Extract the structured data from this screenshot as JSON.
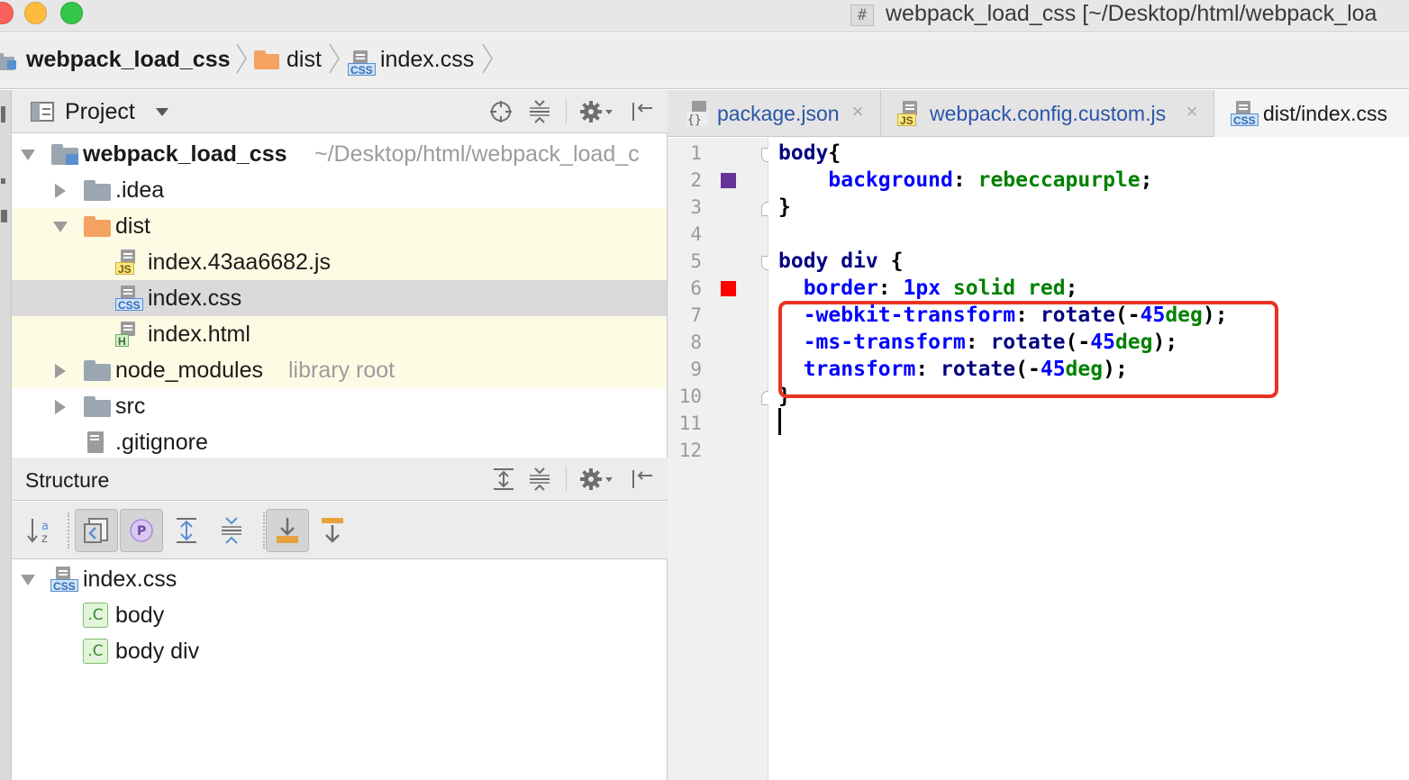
{
  "window": {
    "title": "webpack_load_css [~/Desktop/html/webpack_loa",
    "title_icon": "#"
  },
  "breadcrumb": [
    {
      "label": "webpack_load_css",
      "icon": "module-icon"
    },
    {
      "label": "dist",
      "icon": "folder-icon"
    },
    {
      "label": "index.css",
      "icon": "css-file-icon"
    }
  ],
  "project_panel": {
    "title": "Project",
    "tree": [
      {
        "label": "webpack_load_css",
        "hint": "~/Desktop/html/webpack_load_c",
        "icon": "module-folder-icon",
        "expanded": true
      },
      {
        "label": ".idea",
        "icon": "folder-icon",
        "expanded": false
      },
      {
        "label": "dist",
        "icon": "folder-icon",
        "expanded": true
      },
      {
        "label": "index.43aa6682.js",
        "icon": "js-file-icon"
      },
      {
        "label": "index.css",
        "icon": "css-file-icon",
        "selected": true
      },
      {
        "label": "index.html",
        "icon": "html-file-icon"
      },
      {
        "label": "node_modules",
        "hint": "library root",
        "icon": "folder-icon",
        "expanded": false
      },
      {
        "label": "src",
        "icon": "folder-icon",
        "expanded": false
      },
      {
        "label": ".gitignore",
        "icon": "text-file-icon"
      }
    ]
  },
  "structure_panel": {
    "title": "Structure",
    "tree": [
      {
        "label": "index.css",
        "icon": "css-file-icon"
      },
      {
        "label": "body",
        "icon": "css-class-icon"
      },
      {
        "label": "body div",
        "icon": "css-class-icon"
      }
    ]
  },
  "editor": {
    "tabs": [
      {
        "label": "package.json",
        "icon": "json-file-icon",
        "active": false
      },
      {
        "label": "webpack.config.custom.js",
        "icon": "js-file-icon",
        "active": false
      },
      {
        "label": "dist/index.css",
        "icon": "css-file-icon",
        "active": true
      }
    ],
    "line_numbers": [
      "1",
      "2",
      "3",
      "4",
      "5",
      "6",
      "7",
      "8",
      "9",
      "10",
      "11",
      "12"
    ],
    "swatch_colors": {
      "line2": "#663399",
      "line6": "#ff0000"
    },
    "highlight_color": "#ea3323",
    "lines": {
      "l1": {
        "sel": "body",
        "pun": "{"
      },
      "l2": {
        "prop": "background",
        "colon": ":",
        "val": "rebeccapurple",
        "end": ";"
      },
      "l3": {
        "pun": "}"
      },
      "l5": {
        "sel": "body div",
        "pun": " {"
      },
      "l6": {
        "prop": "border",
        "colon": ":",
        "num": "1px",
        "val1": "solid",
        "val2": "red",
        "end": ";"
      },
      "l7": {
        "prop": "-webkit-transform",
        "colon": ":",
        "fn": "rotate",
        "open": "(-",
        "num": "45",
        "unit": "deg",
        "end": ");"
      },
      "l8": {
        "prop": "-ms-transform",
        "colon": ":",
        "fn": "rotate",
        "open": "(-",
        "num": "45",
        "unit": "deg",
        "end": ");"
      },
      "l9": {
        "prop": "transform",
        "colon": ":",
        "fn": "rotate",
        "open": "(-",
        "num": "45",
        "unit": "deg",
        "end": ");"
      },
      "l10": {
        "pun": "}"
      }
    }
  }
}
